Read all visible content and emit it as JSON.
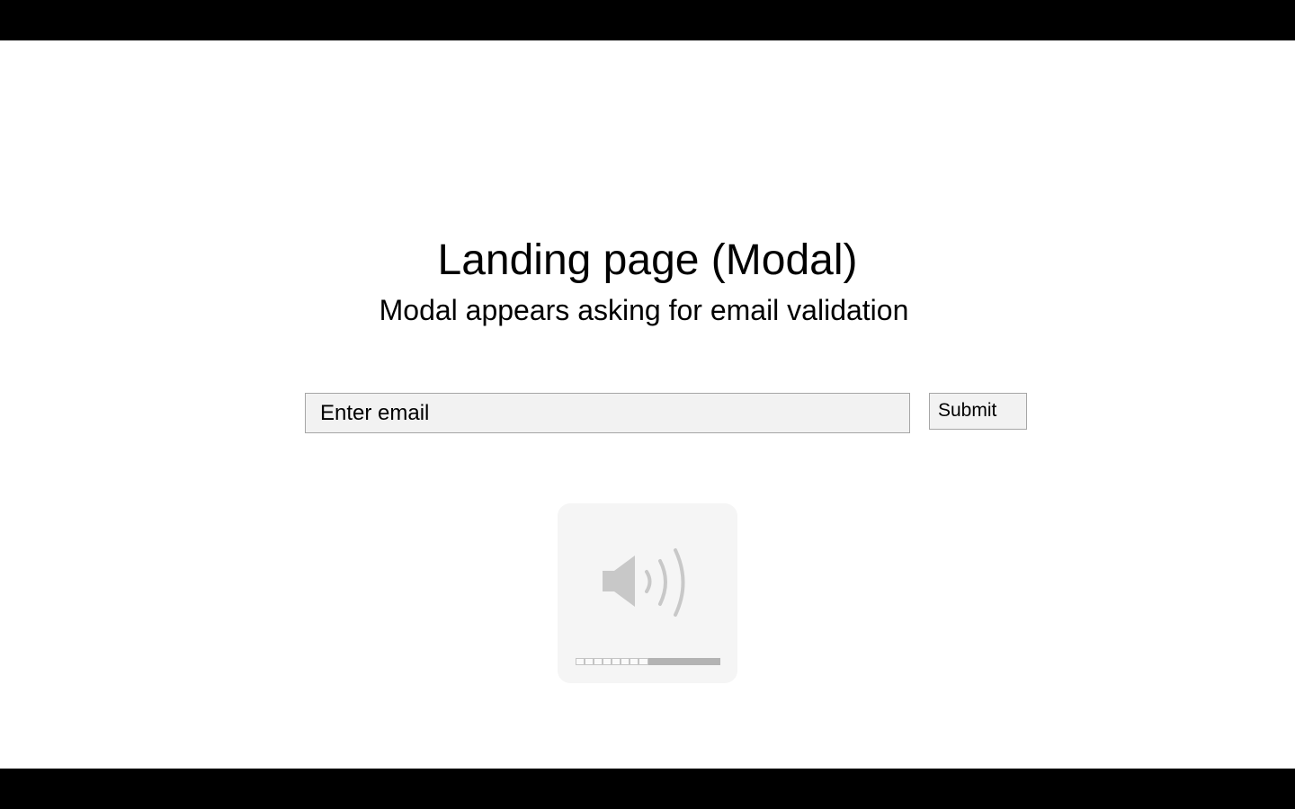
{
  "slide": {
    "title": "Landing page (Modal)",
    "subtitle": "Modal appears asking for email validation"
  },
  "form": {
    "email_placeholder": "Enter email",
    "submit_label": "Submit"
  },
  "volume_hud": {
    "icon": "speaker-volume-icon",
    "level": 0.5,
    "segments_total": 16,
    "segments_filled": 8
  },
  "colors": {
    "letterbox": "#000000",
    "slide_background": "#ffffff",
    "field_background": "#f2f2f2",
    "field_border": "#a6a6a6",
    "hud_background": "#f5f5f5",
    "hud_icon": "#c8c8c8"
  }
}
